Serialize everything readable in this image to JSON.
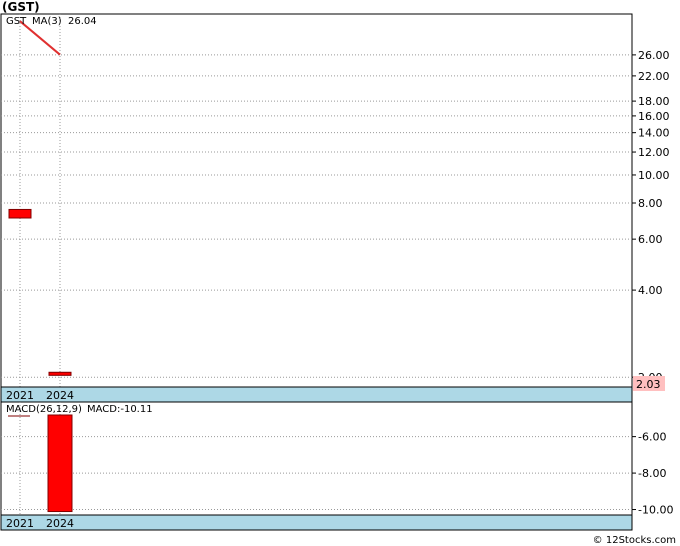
{
  "ticker_label": "(GST)",
  "watermark": "© 12Stocks.com",
  "colors": {
    "background": "#ffffff",
    "bar": "#ff0000",
    "bar_outline": "#800000",
    "ma_line": "#e03030",
    "axis_strip": "#add8e6",
    "price_tag_bg": "#ffc0c0",
    "grid": "#999999",
    "legend_symbol": "#008000",
    "legend_ma": "#0000a0"
  },
  "chart_data": [
    {
      "type": "bar",
      "title": "",
      "scale": "log",
      "ylim": [
        1.85,
        36
      ],
      "grid": true,
      "legend": [
        "GST",
        "MA(3)  26.04"
      ],
      "categories": [
        "2021",
        "2024"
      ],
      "yticks": [
        "26.00",
        "22.00",
        "18.00",
        "16.00",
        "14.00",
        "12.00",
        "10.00",
        "8.00",
        "6.00",
        "4.00",
        "2.00"
      ],
      "last_price_label": "2.03",
      "bars": [
        {
          "x": "2021",
          "open": 7.6,
          "close": 7.1
        },
        {
          "x": "2024",
          "open": 2.08,
          "close": 2.03
        }
      ],
      "ma": {
        "name": "MA(3)",
        "last": 26.04,
        "points": [
          {
            "x": "2021",
            "y": 34
          },
          {
            "x": "2024",
            "y": 26.04
          }
        ]
      }
    },
    {
      "type": "bar",
      "title": "",
      "legend": [
        "MACD(26,12,9)",
        "MACD:-10.11"
      ],
      "categories": [
        "2021",
        "2024"
      ],
      "ylim": [
        -10.3,
        -4.1
      ],
      "yticks": [
        "-6.00",
        "-8.00",
        "-10.00"
      ],
      "grid": true,
      "values": [
        {
          "x": "2024",
          "y": -10.11
        }
      ]
    }
  ]
}
